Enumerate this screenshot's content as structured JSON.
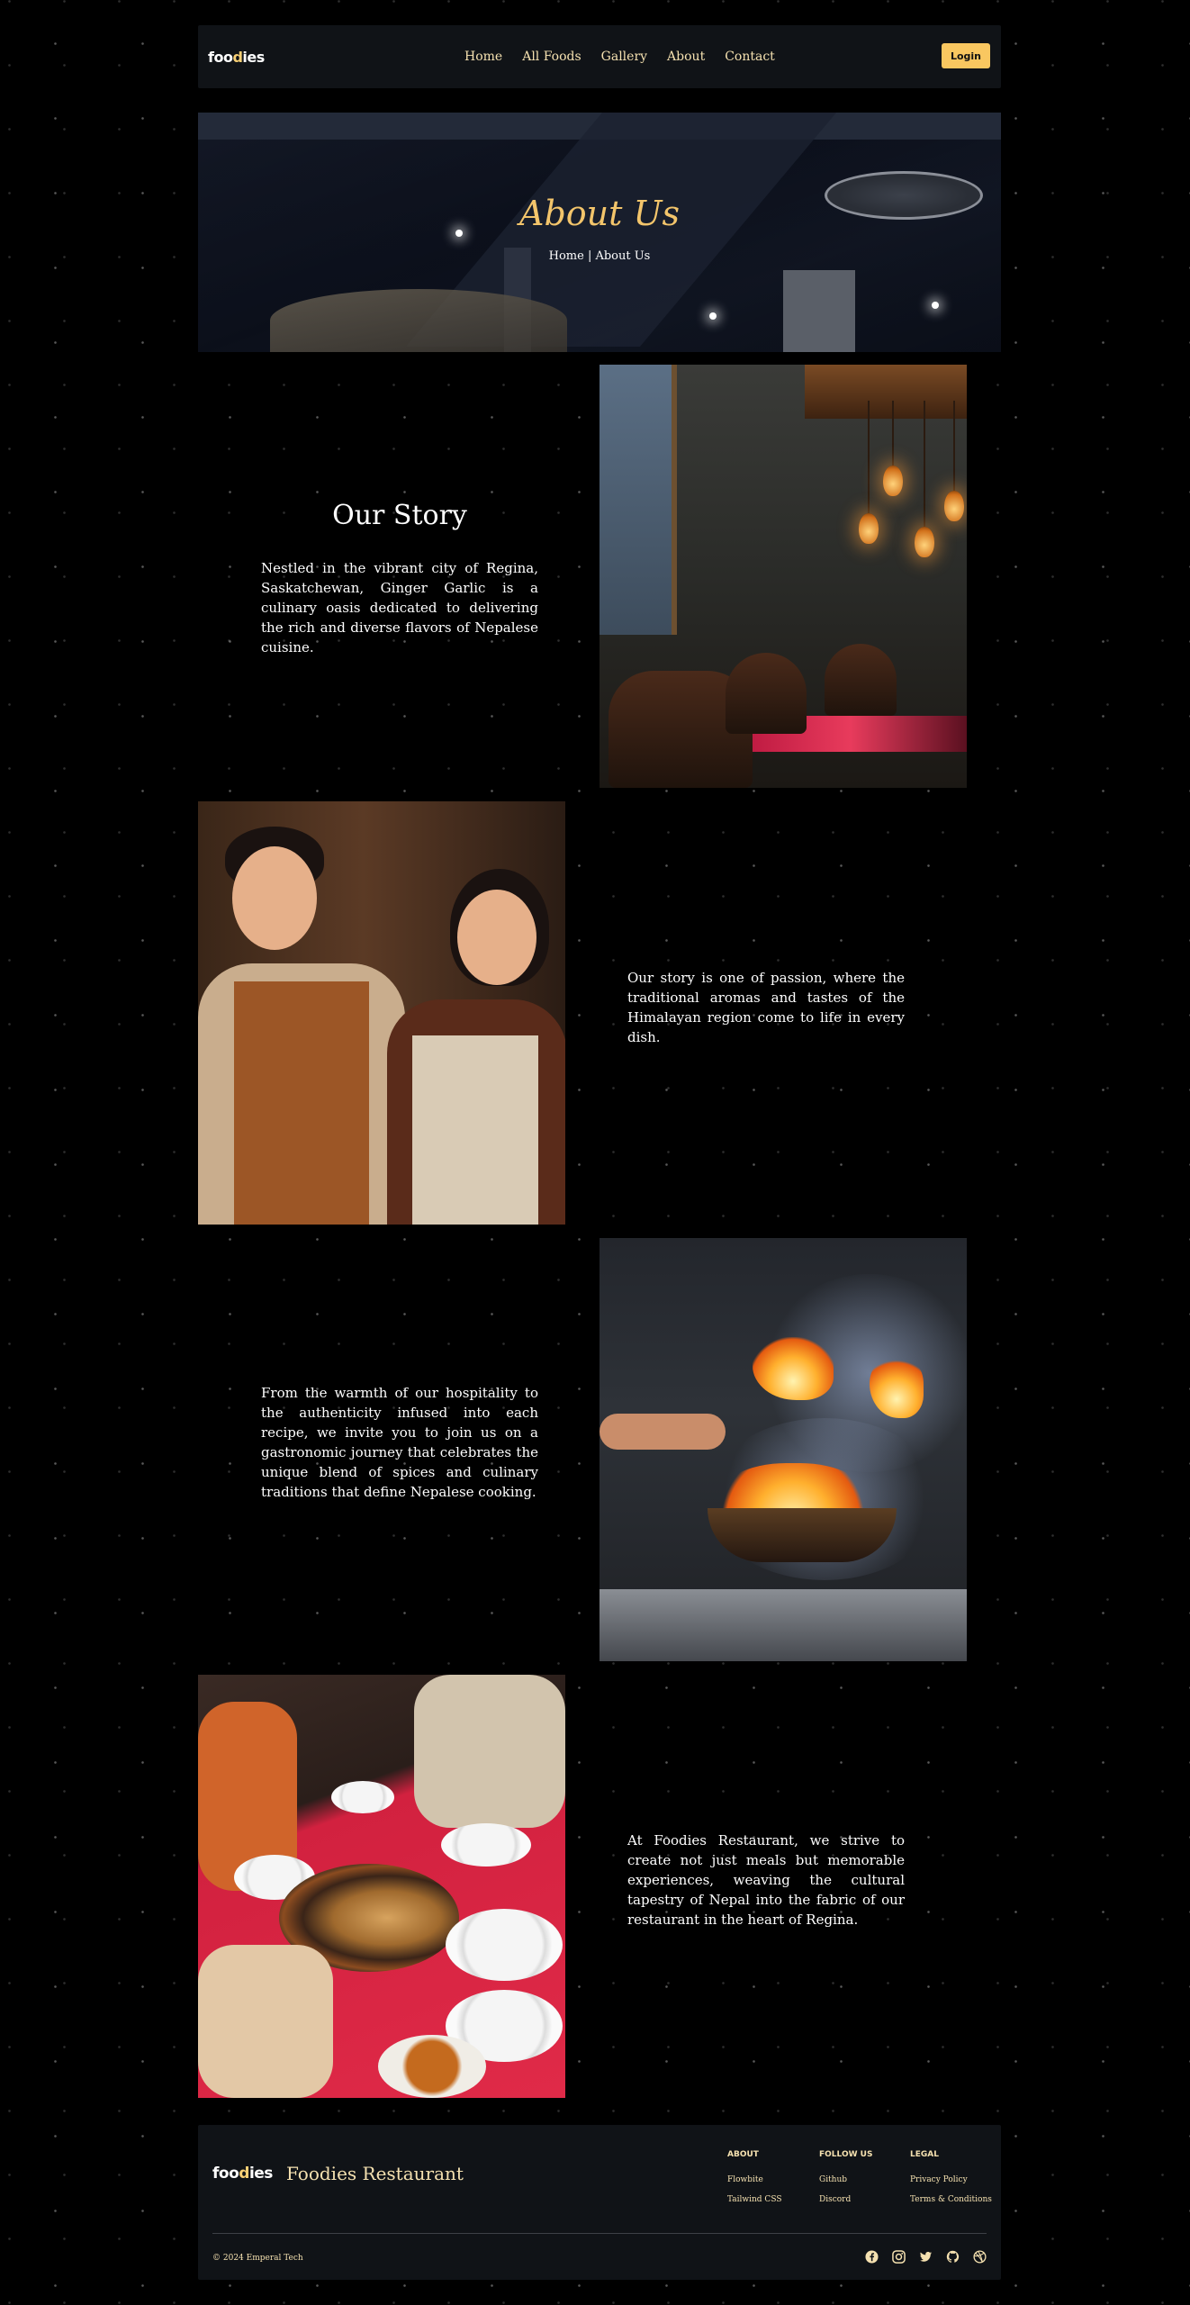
{
  "nav": {
    "logo_prefix": "foo",
    "logo_mid": "d",
    "logo_suffix": "ies",
    "items": [
      "Home",
      "All Foods",
      "Gallery",
      "About",
      "Contact"
    ],
    "login": "Login"
  },
  "hero": {
    "title": "About Us",
    "crumb": "Home | About Us"
  },
  "story": {
    "title": "Our Story",
    "p1": "Nestled in the vibrant city of Regina, Saskatchewan, Ginger Garlic is a culinary oasis dedicated to delivering the rich and diverse flavors of Nepalese cuisine.",
    "p2": "Our story is one of passion, where the traditional aromas and tastes of the Himalayan region come to life in every dish.",
    "p3": "From the warmth of our hospitality to the authenticity infused into each recipe, we invite you to join us on a gastronomic journey that celebrates the unique blend of spices and culinary traditions that define Nepalese cooking.",
    "p4": "At Foodies Restaurant, we strive to create not just meals but memorable experiences, weaving the cultural tapestry of Nepal into the fabric of our restaurant in the heart of Regina."
  },
  "footer": {
    "logo_prefix": "foo",
    "logo_mid": "d",
    "logo_suffix": "ies",
    "brand": "Foodies Restaurant",
    "about_heading": "ABOUT",
    "about_links": [
      "Flowbite",
      "Tailwind CSS"
    ],
    "follow_heading": "FOLLOW US",
    "follow_links": [
      "Github",
      "Discord"
    ],
    "legal_heading": "LEGAL",
    "legal_links": [
      "Privacy Policy",
      "Terms & Conditions"
    ],
    "copyright": "© 2024 Emperal Tech",
    "social_icons": [
      "facebook-icon",
      "instagram-icon",
      "twitter-icon",
      "github-icon",
      "dribbble-icon"
    ]
  },
  "colors": {
    "accent": "#f9c760",
    "gold_text": "#f5e1b0",
    "panel": "#101317"
  }
}
